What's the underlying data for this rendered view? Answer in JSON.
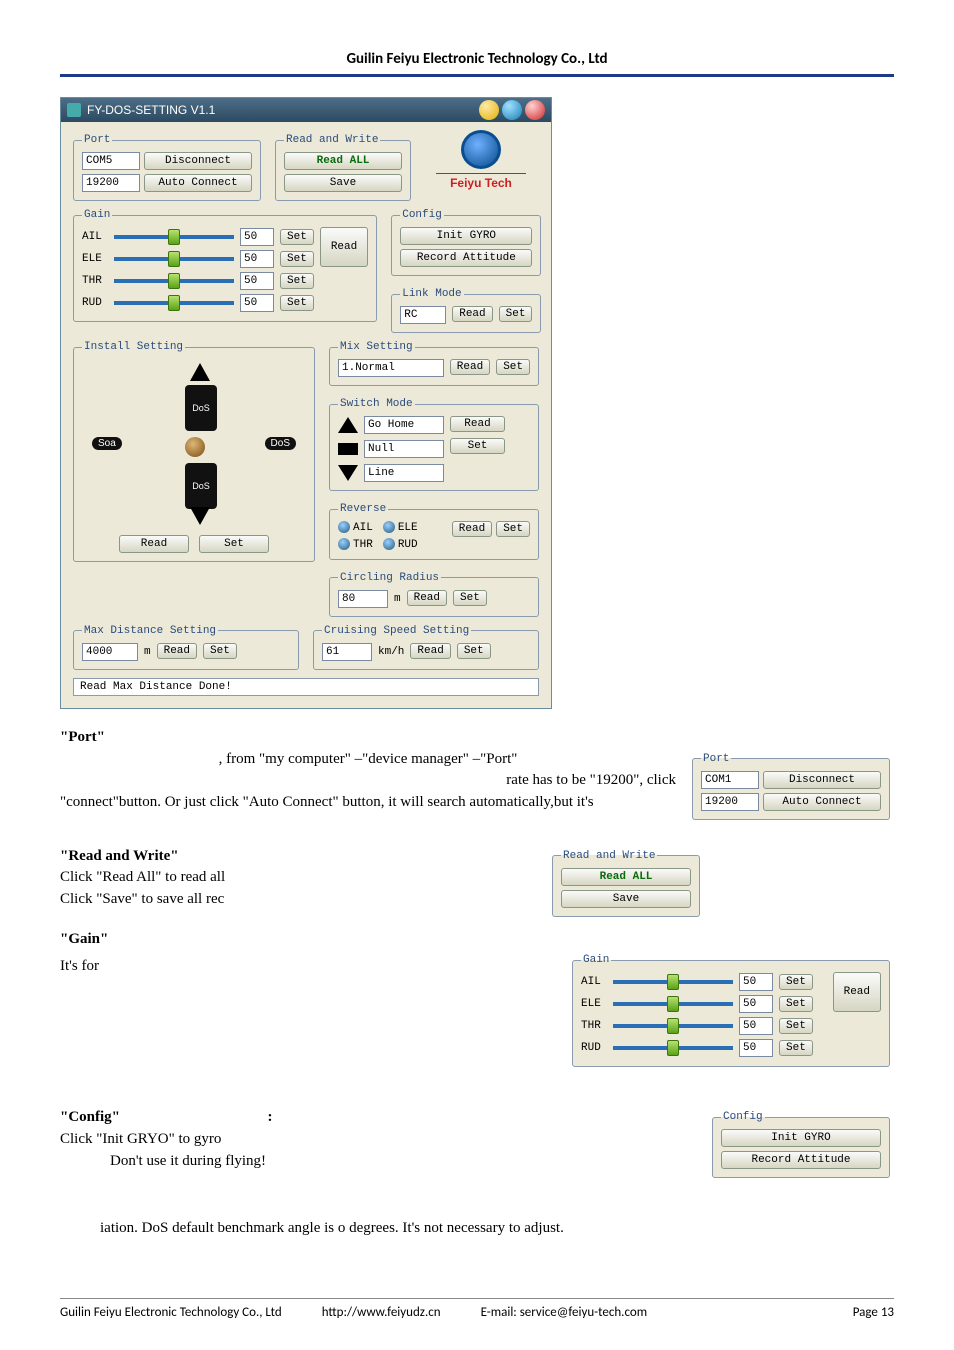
{
  "doc": {
    "header": "Guilin Feiyu Electronic Technology Co., Ltd",
    "footer": {
      "company": "Guilin Feiyu Electronic Technology Co., Ltd",
      "url": "http://www.feiyudz.cn",
      "email": "E-mail: service@feiyu-tech.com",
      "page": "Page 13"
    }
  },
  "app": {
    "title": "FY-DOS-SETTING V1.1",
    "logo_text": "Feiyu Tech",
    "status": "Read Max Distance Done!",
    "port": {
      "legend": "Port",
      "com": "COM5",
      "baud": "19200",
      "disconnect": "Disconnect",
      "auto": "Auto Connect"
    },
    "rw": {
      "legend": "Read and Write",
      "read_all": "Read ALL",
      "save": "Save"
    },
    "gain": {
      "legend": "Gain",
      "rows": [
        {
          "label": "AIL",
          "val": "50"
        },
        {
          "label": "ELE",
          "val": "50"
        },
        {
          "label": "THR",
          "val": "50"
        },
        {
          "label": "RUD",
          "val": "50"
        }
      ],
      "set": "Set",
      "read": "Read"
    },
    "config": {
      "legend": "Config",
      "init": "Init GYRO",
      "rec": "Record Attitude"
    },
    "link": {
      "legend": "Link Mode",
      "val": "RC",
      "read": "Read",
      "set": "Set"
    },
    "install": {
      "legend": "Install Setting",
      "read": "Read",
      "set": "Set",
      "left": "Soa",
      "right": "DoS"
    },
    "mix": {
      "legend": "Mix Setting",
      "val": "1.Normal",
      "read": "Read",
      "set": "Set"
    },
    "switch": {
      "legend": "Switch Mode",
      "rows": [
        "Go Home",
        "Null",
        "Line"
      ],
      "read": "Read",
      "set": "Set"
    },
    "reverse": {
      "legend": "Reverse",
      "items": [
        "AIL",
        "ELE",
        "THR",
        "RUD"
      ],
      "read": "Read",
      "set": "Set"
    },
    "circ": {
      "legend": "Circling Radius",
      "val": "80",
      "unit": "m",
      "read": "Read",
      "set": "Set"
    },
    "maxd": {
      "legend": "Max Distance Setting",
      "val": "4000",
      "unit": "m",
      "read": "Read",
      "set": "Set"
    },
    "cruise": {
      "legend": "Cruising Speed Setting",
      "val": "61",
      "unit": "km/h",
      "read": "Read",
      "set": "Set"
    }
  },
  "body": {
    "s_port_h": "\"Port\"",
    "s_port_1": ", from \"my computer\" –\"device manager\" –\"Port\"",
    "s_port_2": "rate has to be \"19200\", click",
    "s_port_3": "\"connect\"button. Or just click \"Auto Connect\" button, it will search automatically,but it's",
    "s_rw_h": "\"Read and Write\"",
    "s_rw_1": "Click \"Read All\" to read all",
    "s_rw_2": "Click \"Save\" to save all rec",
    "s_gain_h": "\"Gain\"",
    "s_gain_1": "It's for",
    "s_cfg_h": "\"Config\"",
    "s_cfg_colon": ":",
    "s_cfg_1": "Click \"Init  GRYO\" to gyro",
    "s_cfg_2": "Don't use it during flying!",
    "s_tail": "iation. DoS default benchmark angle is o degrees. It's not necessary to adjust."
  },
  "snips": {
    "port": {
      "legend": "Port",
      "com": "COM1",
      "baud": "19200",
      "disconnect": "Disconnect",
      "auto": "Auto Connect"
    }
  }
}
